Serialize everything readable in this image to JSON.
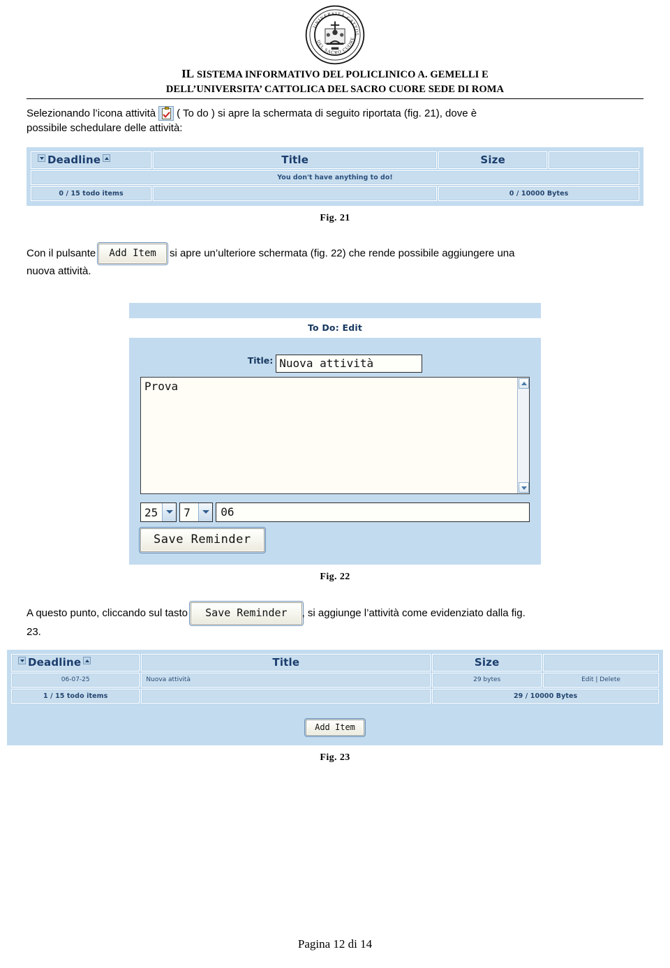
{
  "header": {
    "crest_alt": "university-crest",
    "line1_small_cap": "IL",
    "line1": " SISTEMA INFORMATIVO DEL POLICLINICO A. GEMELLI E",
    "line2": "DELL’UNIVERSITA’ CATTOLICA DEL SACRO CUORE SEDE DI ROMA"
  },
  "paragraphs": {
    "p1_part1": "Selezionando l’icona attività",
    "p1_part2": "( To do ) si apre la schermata di seguito riportata (fig. 21), dove è",
    "p1_part3": "possibile schedulare delle attività:",
    "p2_part1": "Con il pulsante",
    "p2_part2": "si apre un’ulteriore schermata (fig. 22) che rende possibile aggiungere una",
    "p2_part3": "nuova attività.",
    "p3_part1": "A questo punto, cliccando sul tasto",
    "p3_part2": ", si aggiunge l’attività come evidenziato dalla  fig.",
    "p3_part3": "23."
  },
  "buttons": {
    "add_item": "Add Item",
    "save_reminder": "Save Reminder"
  },
  "fig21": {
    "caption": "Fig.  21",
    "columns": [
      "Deadline",
      "Title",
      "Size",
      ""
    ],
    "empty_message": "You don't have anything to do!",
    "footer_items": "0 / 15 todo items",
    "footer_bytes": "0 / 10000 Bytes"
  },
  "fig22": {
    "caption": "Fig.  22",
    "panel_title": "To Do: Edit",
    "title_label": "Title:",
    "title_value": "Nuova attività",
    "body_value": "Prova",
    "day_value": "25",
    "month_value": "7",
    "year_value": "06",
    "save_button": "Save Reminder"
  },
  "fig23": {
    "caption": "Fig.  23",
    "columns": [
      "Deadline",
      "Title",
      "Size",
      ""
    ],
    "row": {
      "deadline": "06-07-25",
      "title": "Nuova attività",
      "size": "29 bytes",
      "actions": "Edit | Delete"
    },
    "footer_items": "1 / 15 todo items",
    "footer_bytes": "29 / 10000 Bytes",
    "add_item": "Add Item"
  },
  "footer": {
    "page_label": "Pagina 12 di 14"
  },
  "colors": {
    "panel_blue": "#c3dbef",
    "cell_blue": "#c8deef",
    "header_text_blue": "#1b3d6d"
  }
}
